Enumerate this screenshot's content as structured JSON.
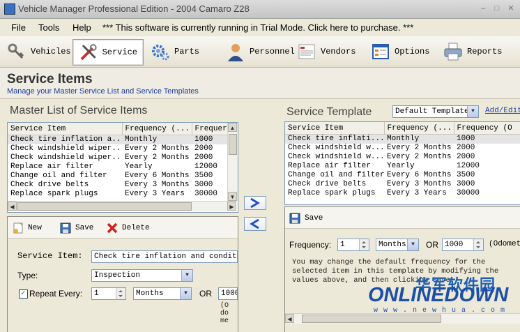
{
  "window": {
    "title": "Vehicle Manager Professional Edition - 2004 Camaro Z28",
    "min": "–",
    "max": "□",
    "close": "✕"
  },
  "menu": {
    "file": "File",
    "tools": "Tools",
    "help": "Help",
    "notice": "*** This software is currently running in Trial Mode.  Click here to purchase. ***"
  },
  "toolbar": {
    "vehicles": "Vehicles",
    "service": "Service",
    "parts": "Parts",
    "personnel": "Personnel",
    "vendors": "Vendors",
    "options": "Options",
    "reports": "Reports"
  },
  "header": {
    "title": "Service Items",
    "subtitle": "Manage your Master Service List and Service Templates"
  },
  "master": {
    "title": "Master List of Service Items",
    "columns": [
      "Service Item",
      "Frequency (...",
      "Frequer"
    ],
    "rows": [
      [
        "Check tire inflation a...",
        "Monthly",
        "1000"
      ],
      [
        "Check windshield wiper...",
        "Every 2 Months",
        "2000"
      ],
      [
        "Check windshield wiper...",
        "Every 2 Months",
        "2000"
      ],
      [
        "Replace air filter",
        "Yearly",
        "12000"
      ],
      [
        "Change oil and filter",
        "Every 6 Months",
        "3500"
      ],
      [
        "Check drive belts",
        "Every 3 Months",
        "3000"
      ],
      [
        "Replace spark plugs",
        "Every 3 Years",
        "30000"
      ]
    ]
  },
  "template": {
    "title": "Service Template",
    "selected": "Default Template",
    "addedit": "Add/Edit",
    "columns": [
      "Service Item",
      "Frequency (...",
      "Frequency (O"
    ],
    "rows": [
      [
        "Check tire inflati...",
        "Monthly",
        "1000"
      ],
      [
        "Check windshield w...",
        "Every 2 Months",
        "2000"
      ],
      [
        "Check windshield w...",
        "Every 2 Months",
        "2000"
      ],
      [
        "Replace air filter",
        "Yearly",
        "12000"
      ],
      [
        "Change oil and filter",
        "Every 6 Months",
        "3500"
      ],
      [
        "Check drive belts",
        "Every 3 Months",
        "3000"
      ],
      [
        "Replace spark plugs",
        "Every 3 Years",
        "30000"
      ]
    ]
  },
  "editor": {
    "new": "New",
    "save": "Save",
    "delete": "Delete",
    "service_item_label": "Service Item:",
    "service_item_value": "Check tire inflation and condition",
    "type_label": "Type:",
    "type_value": "Inspection",
    "repeat_label": "Repeat Every:",
    "repeat_value": "1",
    "repeat_unit": "Months",
    "or": "OR",
    "odometer_value": "1000",
    "odo_wrap_1": "(O",
    "odo_wrap_2": "do",
    "odo_wrap_3": "me",
    "checked": "✓"
  },
  "tpl_editor": {
    "save": "Save",
    "freq_label": "Frequency:",
    "freq_value": "1",
    "freq_unit": "Months",
    "or": "OR",
    "odometer_value": "1000",
    "odo_label": "(Odomet",
    "hint_1": "You may change the default      frequency for the",
    "hint_2": "selected item in this  template by modifying the",
    "hint_3": "values above, and then clicking Save."
  },
  "transfer": {
    "add": "Add to template",
    "remove": "Remove from template"
  },
  "watermark": {
    "cn": "华军软件园",
    "brand": "ONLINEDOWN",
    "url": "w w w . n e w h u a . c o m"
  },
  "colors": {
    "accent": "#1f3d9c",
    "arrow": "#1e50c8"
  }
}
